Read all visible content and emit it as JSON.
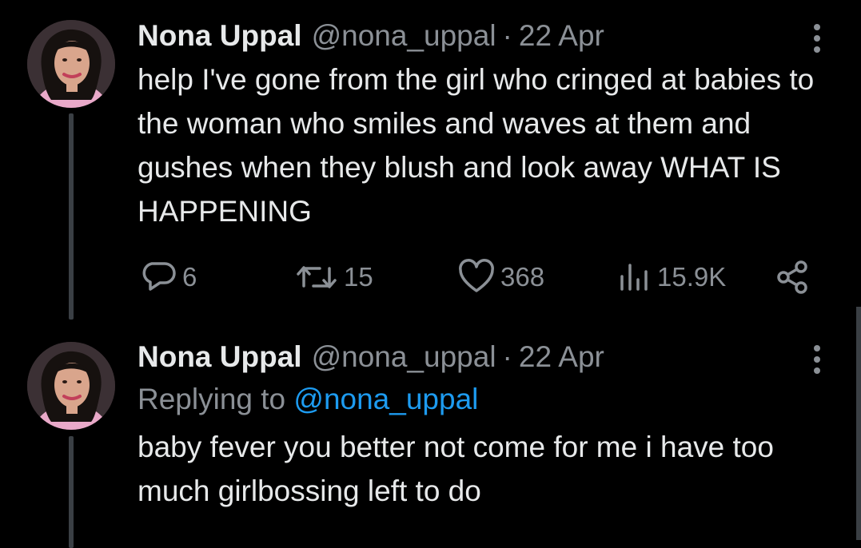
{
  "tweets": [
    {
      "name": "Nona Uppal",
      "handle": "@nona_uppal",
      "separator": "·",
      "date": "22 Apr",
      "text": "help I've gone from the girl who cringed at babies to the woman who smiles and waves at them and gushes when they blush and look away WHAT IS HAPPENING",
      "actions": {
        "replies": "6",
        "retweets": "15",
        "likes": "368",
        "views": "15.9K"
      }
    },
    {
      "name": "Nona Uppal",
      "handle": "@nona_uppal",
      "separator": "·",
      "date": "22 Apr",
      "reply_prefix": "Replying to ",
      "reply_mention": "@nona_uppal",
      "text": "baby fever you better not come for me i have too much girlbossing left to do"
    }
  ],
  "colors": {
    "background": "#000000",
    "text": "#e7e9ea",
    "secondary": "#8b9096",
    "link": "#1d9bf0",
    "thread_line": "#3a3f44"
  },
  "icons": {
    "more": "more-vertical-icon",
    "reply": "reply-bubble-icon",
    "retweet": "retweet-icon",
    "like": "heart-icon",
    "views": "views-chart-icon",
    "share": "share-icon"
  }
}
